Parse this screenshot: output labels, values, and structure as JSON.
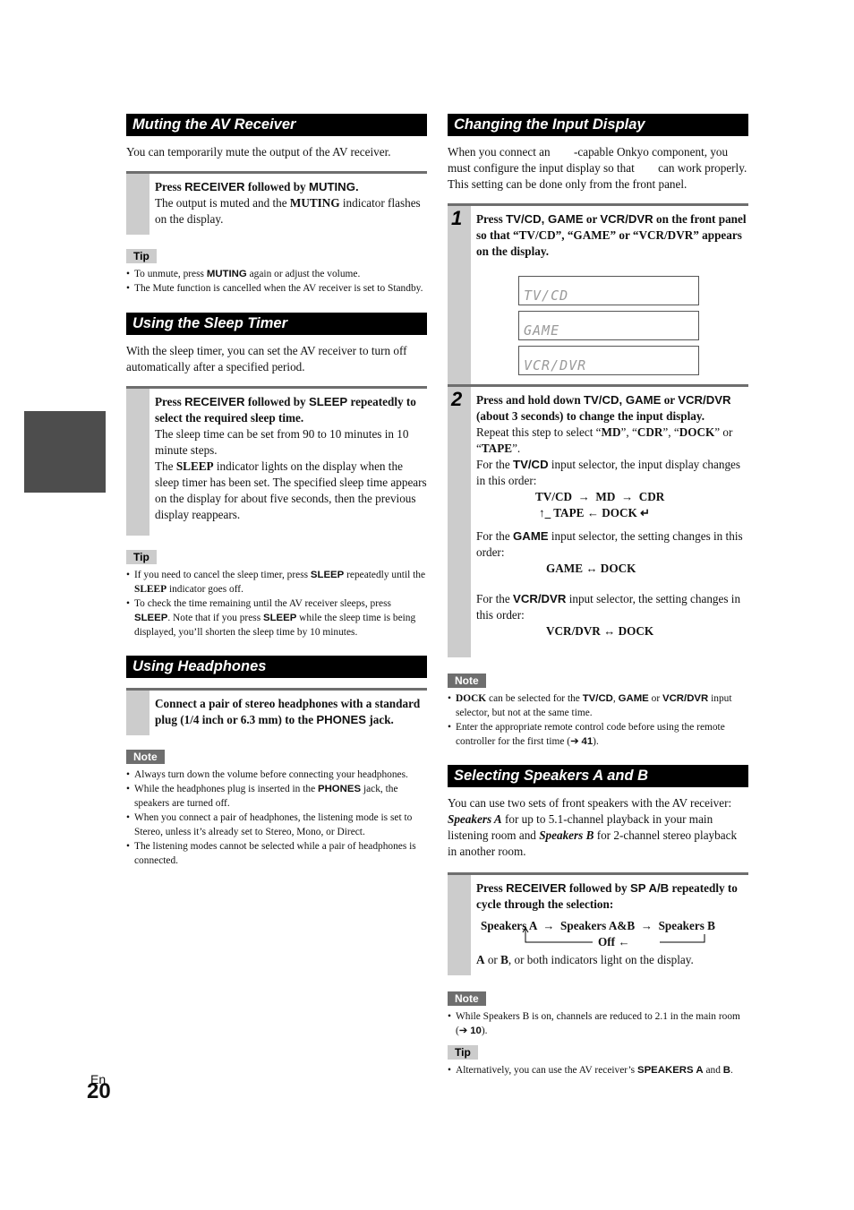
{
  "page": {
    "language": "En",
    "number": "20"
  },
  "left": {
    "muting": {
      "title": "Muting the AV Receiver",
      "intro": "You can temporarily mute the output of the AV receiver.",
      "step": {
        "instr_a": "Press ",
        "instr_b": "RECEIVER",
        "instr_c": " followed by ",
        "instr_d": "MUTING.",
        "body_a": "The output is muted and the ",
        "body_b": "MUTING",
        "body_c": " indicator flashes on the display."
      },
      "tip_label": "Tip",
      "tips": [
        {
          "a": "To unmute, press ",
          "b": "MUTING",
          "c": " again or adjust the volume."
        },
        {
          "a": "The Mute function is cancelled when the AV receiver is set to Standby."
        }
      ]
    },
    "sleep": {
      "title": "Using the Sleep Timer",
      "intro": "With the sleep timer, you can set the AV receiver to turn off automatically after a specified period.",
      "step": {
        "instr_a": "Press ",
        "instr_b": "RECEIVER",
        "instr_c": " followed by ",
        "instr_d": "SLEEP",
        "instr_e": " repeatedly to select the required sleep time.",
        "body1": "The sleep time can be set from 90 to 10 minutes in 10 minute steps.",
        "body2_a": "The ",
        "body2_b": "SLEEP",
        "body2_c": " indicator lights on the display when the sleep timer has been set. The specified sleep time appears on the display for about five seconds, then the previous display reappears."
      },
      "tip_label": "Tip",
      "tips": [
        {
          "a": "If you need to cancel the sleep timer, press ",
          "b": "SLEEP",
          "c": " repeatedly until the ",
          "d": "SLEEP",
          "e": " indicator goes off."
        },
        {
          "a": "To check the time remaining until the AV receiver sleeps, press ",
          "b": "SLEEP",
          "c": ". Note that if you press ",
          "d": "SLEEP",
          "e": " while the sleep time is being displayed, you’ll shorten the sleep time by 10 minutes."
        }
      ]
    },
    "headphones": {
      "title": "Using Headphones",
      "step": {
        "a": "Connect a pair of stereo headphones with a standard plug (1/4 inch or 6.3 mm) to the ",
        "b": "PHONES",
        "c": " jack."
      },
      "note_label": "Note",
      "notes": [
        {
          "a": "Always turn down the volume before connecting your headphones."
        },
        {
          "a": "While the headphones plug is inserted in the ",
          "b": "PHONES",
          "c": " jack, the speakers are turned off."
        },
        {
          "a": "When you connect a pair of headphones, the listening mode is set to Stereo, unless it’s already set to Stereo, Mono, or Direct."
        },
        {
          "a": "The listening modes cannot be selected while a pair of headphones is connected."
        }
      ]
    }
  },
  "right": {
    "input_display": {
      "title": "Changing the Input Display",
      "intro1": "When you connect an        -capable Onkyo component, you must configure the input display so that        can work properly.",
      "intro2": "This setting can be done only from the front panel.",
      "step1": {
        "num": "1",
        "a": "Press ",
        "b": "TV/CD, GAME",
        "c": " or ",
        "d": "VCR/DVR",
        "e": " on the front panel so that “TV/CD”, “GAME” or “VCR/DVR” appears on the display.",
        "displays": [
          "TV/CD",
          "GAME",
          "VCR/DVR"
        ]
      },
      "step2": {
        "num": "2",
        "a": "Press and hold down ",
        "b": "TV/CD, GAME",
        "c": " or ",
        "d": "VCR/DVR",
        "e": " (about 3 seconds) to change the input display.",
        "repeat_a": "Repeat this step to select “",
        "md": "MD",
        "sep1": "”, “",
        "cdr": "CDR",
        "sep2": "”, “",
        "dock": "DOCK",
        "sep3": "” or “",
        "tape": "TAPE",
        "end": "”.",
        "tvcd_a": "For the ",
        "tvcd_b": "TV/CD",
        "tvcd_c": " input selector, the input display changes in this order:",
        "tvcd_flow1": "TV/CD  →  MD  →  CDR",
        "tvcd_flow2": "↑_ TAPE ← DOCK ↵",
        "game_a": "For the ",
        "game_b": "GAME",
        "game_c": " input selector, the setting changes in this order:",
        "game_flow": "GAME ↔ DOCK",
        "vcr_a": "For the ",
        "vcr_b": "VCR/DVR",
        "vcr_c": " input selector, the setting changes in this order:",
        "vcr_flow": "VCR/DVR ↔ DOCK"
      },
      "note_label": "Note",
      "notes": [
        {
          "a": "DOCK",
          "b": " can be selected for the ",
          "c": "TV/CD",
          "d": ", ",
          "e": "GAME",
          "f": " or ",
          "g": "VCR/DVR",
          "h": " input selector, but not at the same time."
        },
        {
          "a": "Enter the appropriate remote control code before using the remote controller for the first time (➔ ",
          "b": "41",
          "c": ")."
        }
      ]
    },
    "speakers": {
      "title": "Selecting Speakers A and B",
      "intro_a": "You can use two sets of front speakers with the AV receiver: ",
      "intro_b": "Speakers A",
      "intro_c": " for up to 5.1-channel playback in your main listening room and ",
      "intro_d": "Speakers B",
      "intro_e": " for 2-channel stereo playback in another room.",
      "step": {
        "a": "Press ",
        "b": "RECEIVER",
        "c": " followed by ",
        "d": "SP A/B",
        "e": " repeatedly to cycle through the selection:",
        "flow": "Speakers A  →  Speakers A&B  →  Speakers B",
        "off": "Off ←",
        "ind_a": "A",
        "ind_b": " or ",
        "ind_c": "B",
        "ind_d": ", or both indicators light on the display."
      },
      "note_label": "Note",
      "notes": [
        {
          "a": "While Speakers B is on, channels are reduced to 2.1 in the main room (➔ ",
          "b": "10",
          "c": ")."
        }
      ],
      "tip_label": "Tip",
      "tips": [
        {
          "a": "Alternatively, you can use the AV receiver’s ",
          "b": "SPEAKERS A",
          "c": " and ",
          "d": "B",
          "e": "."
        }
      ]
    }
  }
}
